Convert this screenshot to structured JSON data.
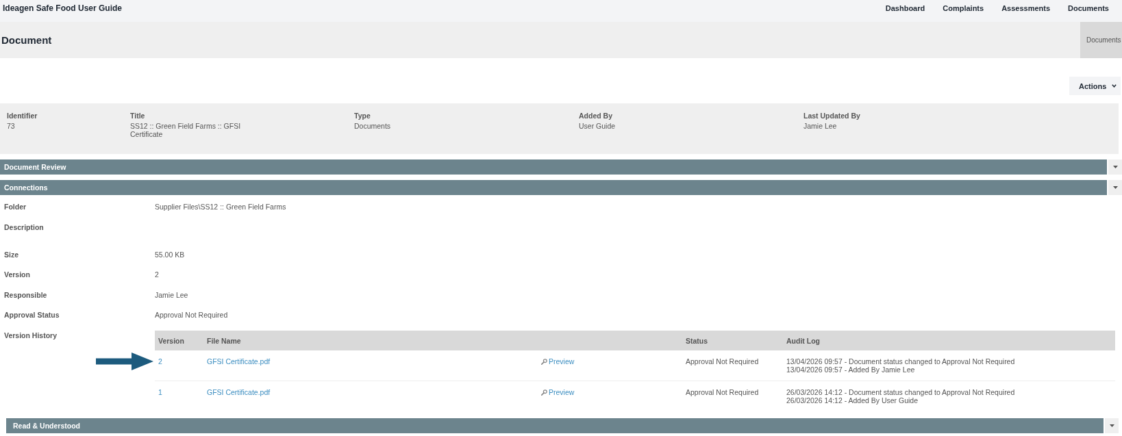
{
  "app_bar": {
    "title": "Ideagen Safe Food User Guide",
    "nav": [
      {
        "label": "Dashboard"
      },
      {
        "label": "Complaints"
      },
      {
        "label": "Assessments"
      },
      {
        "label": "Documents"
      }
    ]
  },
  "page_header": {
    "title": "Document",
    "breadcrumb": "Documents"
  },
  "actions": {
    "label": "Actions"
  },
  "summary": [
    {
      "label": "Identifier",
      "value": "73"
    },
    {
      "label": "Title",
      "value": "SS12 :: Green Field Farms :: GFSI Certificate"
    },
    {
      "label": "Type",
      "value": "Documents"
    },
    {
      "label": "Added By",
      "value": "User Guide"
    },
    {
      "label": "Last Updated By",
      "value": "Jamie Lee"
    }
  ],
  "sections": [
    {
      "title": "Document Review"
    },
    {
      "title": "Connections",
      "fields": [
        {
          "kind": "text",
          "label": "Folder",
          "value": "Supplier Files\\SS12 :: Green Field Farms"
        },
        {
          "kind": "text",
          "label": "Description"
        },
        {
          "kind": "text",
          "label": "Size",
          "value": "55.00 KB"
        },
        {
          "kind": "text",
          "label": "Version",
          "value": "2"
        },
        {
          "kind": "text",
          "label": "Responsible",
          "value": "Jamie Lee"
        },
        {
          "kind": "text",
          "label": "Approval Status",
          "value": "Approval Not Required"
        },
        {
          "kind": "table",
          "label": "Version History",
          "columns": [
            "Version",
            "File Name",
            "Status",
            "Audit Log"
          ],
          "rows": [
            {
              "version": "2",
              "file_name": "GFSI Certificate.pdf",
              "preview": "Preview",
              "status": "Approval Not Required",
              "audit_log": [
                "13/04/2026 09:57 - Document status changed to Approval Not Required",
                "13/04/2026 09:57 - Added By Jamie Lee"
              ],
              "pointed_at": true
            },
            {
              "version": "1",
              "file_name": "GFSI Certificate.pdf",
              "preview": "Preview",
              "status": "Approval Not Required",
              "audit_log": [
                "26/03/2026 14:12 - Document status changed to Approval Not Required",
                "26/03/2026 14:12 - Added By User Guide"
              ],
              "pointed_at": false
            }
          ]
        }
      ],
      "subsections": [
        {
          "title": "Read & Understood"
        }
      ]
    }
  ]
}
